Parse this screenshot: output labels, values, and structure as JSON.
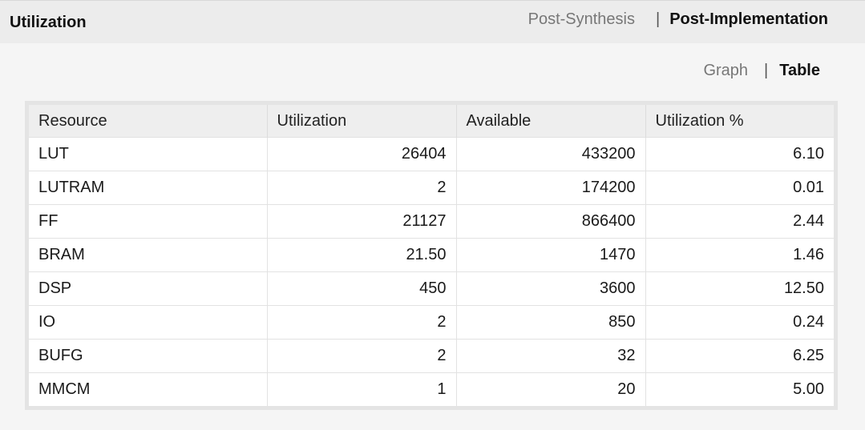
{
  "header": {
    "title": "Utilization",
    "tabs": [
      {
        "label": "Post-Synthesis",
        "active": false
      },
      {
        "label": "Post-Implementation",
        "active": true
      }
    ],
    "separator": "|"
  },
  "view_toggle": {
    "options": [
      {
        "label": "Graph",
        "active": false
      },
      {
        "label": "Table",
        "active": true
      }
    ],
    "separator": "|"
  },
  "table": {
    "columns": [
      "Resource",
      "Utilization",
      "Available",
      "Utilization %"
    ],
    "rows": [
      {
        "resource": "LUT",
        "utilization": "26404",
        "available": "433200",
        "percent": "6.10"
      },
      {
        "resource": "LUTRAM",
        "utilization": "2",
        "available": "174200",
        "percent": "0.01"
      },
      {
        "resource": "FF",
        "utilization": "21127",
        "available": "866400",
        "percent": "2.44"
      },
      {
        "resource": "BRAM",
        "utilization": "21.50",
        "available": "1470",
        "percent": "1.46"
      },
      {
        "resource": "DSP",
        "utilization": "450",
        "available": "3600",
        "percent": "12.50"
      },
      {
        "resource": "IO",
        "utilization": "2",
        "available": "850",
        "percent": "0.24"
      },
      {
        "resource": "BUFG",
        "utilization": "2",
        "available": "32",
        "percent": "6.25"
      },
      {
        "resource": "MMCM",
        "utilization": "1",
        "available": "20",
        "percent": "5.00"
      }
    ]
  }
}
